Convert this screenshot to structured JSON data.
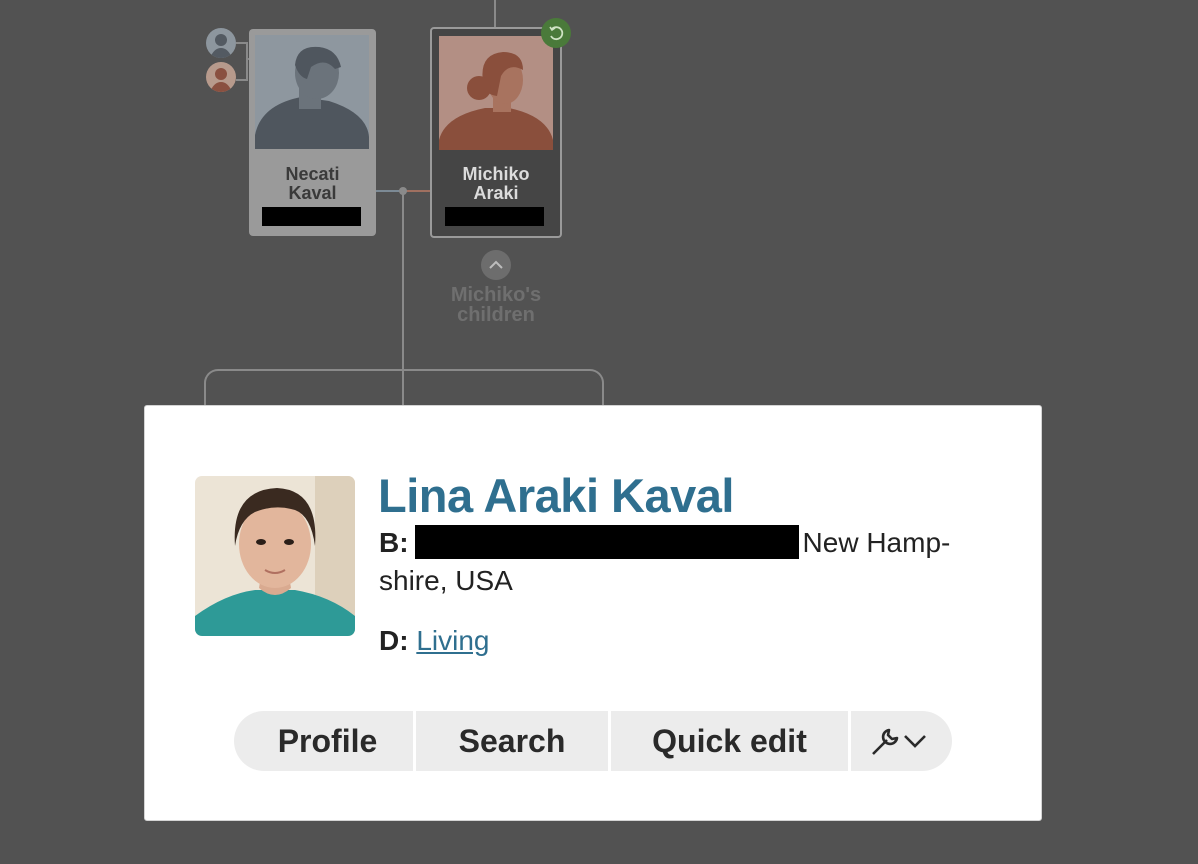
{
  "tree": {
    "father": {
      "name": "Necati\nKaval"
    },
    "mother": {
      "name": "Michiko\nAraki"
    },
    "children_toggle_label": "Michiko's\nchildren"
  },
  "popup": {
    "name": "Lina Araki Kaval",
    "birth_label": "B:",
    "birth_place": "New Hamp-shire, USA",
    "death_label": "D:",
    "death_value": "Living",
    "buttons": {
      "profile": "Profile",
      "search": "Search",
      "quick_edit": "Quick edit"
    }
  },
  "icons": {
    "tools": "wrench-icon",
    "dropdown": "chevron-down-icon",
    "refresh": "refresh-icon",
    "expand": "chevron-up-icon"
  },
  "colors": {
    "name_link": "#2f6f8f",
    "background": "#525252",
    "refresh_badge": "#4a7a3a"
  }
}
